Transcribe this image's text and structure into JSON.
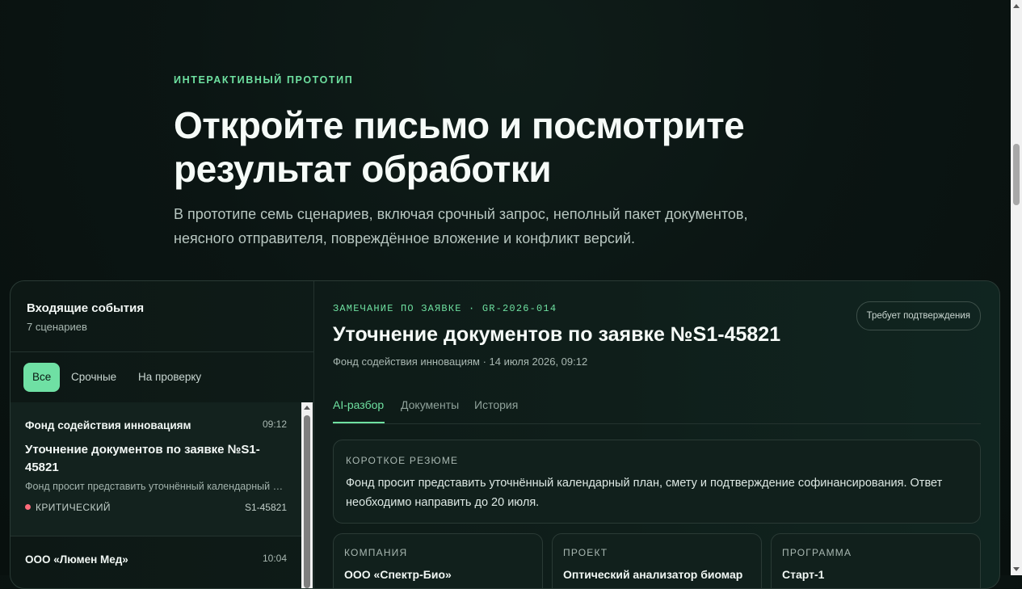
{
  "hero": {
    "eyebrow": "ИНТЕРАКТИВНЫЙ ПРОТОТИП",
    "title": "Откройте письмо и посмотрите результат обработки",
    "subtitle": "В прототипе семь сценариев, включая срочный запрос, неполный пакет документов, неясного отправителя, повреждённое вложение и конфликт версий."
  },
  "inbox": {
    "title": "Входящие события",
    "count": "7 сценариев",
    "filters": [
      {
        "label": "Все"
      },
      {
        "label": "Срочные"
      },
      {
        "label": "На проверку"
      }
    ],
    "items": [
      {
        "sender": "Фонд содействия инновациям",
        "time": "09:12",
        "subject": "Уточнение документов по заявке №S1-45821",
        "preview": "Фонд просит представить уточнённый календарный план, смету и подтверждение софинансирования.",
        "priority": "КРИТИЧЕСКИЙ",
        "id": "S1-45821"
      },
      {
        "sender": "ООО «Люмен Мед»",
        "time": "10:04"
      }
    ]
  },
  "detail": {
    "eyebrow": "ЗАМЕЧАНИЕ ПО ЗАЯВКЕ · GR-2026-014",
    "badge": "Требует подтверждения",
    "title": "Уточнение документов по заявке №S1-45821",
    "meta": "Фонд содействия инновациям · 14 июля 2026, 09:12",
    "tabs": [
      {
        "label": "AI-разбор"
      },
      {
        "label": "Документы"
      },
      {
        "label": "История"
      }
    ],
    "summary": {
      "label": "КОРОТКОЕ РЕЗЮМЕ",
      "text": "Фонд просит представить уточнённый календарный план, смету и подтверждение софинансирования. Ответ необходимо направить до 20 июля."
    },
    "cards": [
      {
        "label": "КОМПАНИЯ",
        "value": "ООО «Спектр-Био»"
      },
      {
        "label": "ПРОЕКТ",
        "value": "Оптический анализатор биомар"
      },
      {
        "label": "ПРОГРАММА",
        "value": "Старт-1"
      }
    ]
  },
  "colors": {
    "accent": "#6ee0a0",
    "background": "#0b1513",
    "critical": "#ff6b7a"
  }
}
